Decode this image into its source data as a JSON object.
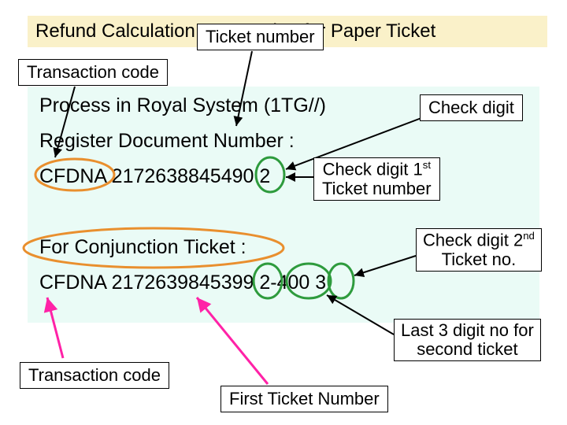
{
  "title": "Refund Calculation Transaction for Paper Ticket",
  "labels": {
    "ticket_number": "Ticket number",
    "transaction_code_top": "Transaction code",
    "check_digit": "Check digit",
    "check_digit_1st_l1": "Check digit 1",
    "check_digit_1st_sup": "st",
    "check_digit_1st_l2": "Ticket number",
    "check_digit_2nd_l1": "Check digit 2",
    "check_digit_2nd_sup": "nd",
    "check_digit_2nd_l2": "Ticket no.",
    "last3_l1": "Last 3 digit no for",
    "last3_l2": "second ticket",
    "transaction_code_bottom": "Transaction code",
    "first_ticket_number": "First Ticket Number"
  },
  "body": {
    "line1": "Process in Royal System (1TG//)",
    "line2": "Register Document Number :",
    "line3": "CFDNA 2172638845490 2",
    "line4": "For Conjunction Ticket :",
    "line5": "CFDNA 2172639845399 2-400 3"
  }
}
